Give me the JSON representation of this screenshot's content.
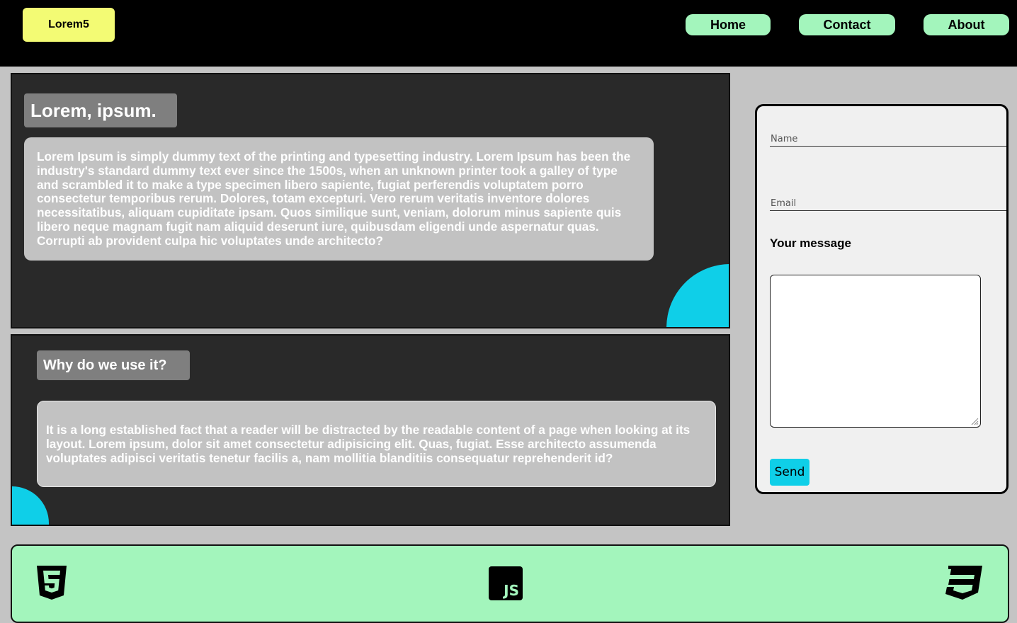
{
  "header": {
    "logo_text": "Lorem5",
    "nav": {
      "home": "Home",
      "contact": "Contact",
      "about": "About"
    }
  },
  "section1": {
    "title": "Lorem, ipsum.",
    "text": "Lorem Ipsum is simply dummy text of the printing and typesetting industry. Lorem Ipsum has been the industry's standard dummy text ever since the 1500s, when an unknown printer took a galley of type and scrambled it to make a type specimen libero sapiente, fugiat perferendis voluptatem porro consectetur temporibus rerum. Dolores, totam excepturi. Vero rerum veritatis inventore dolores necessitatibus, aliquam cupiditate ipsam. Quos similique sunt, veniam, dolorum minus sapiente quis libero neque magnam fugit nam aliquid deserunt iure, quibusdam eligendi unde aspernatur quas. Corrupti ab provident culpa hic voluptates unde architecto?"
  },
  "section2": {
    "title": "Why do we use it?",
    "text": "It is a long established fact that a reader will be distracted by the readable content of a page when looking at its layout. Lorem ipsum, dolor sit amet consectetur adipisicing elit. Quas, fugiat. Esse architecto assumenda voluptates adipisci veritatis tenetur facilis a, nam mollitia blanditiis consequatur reprehenderit id?"
  },
  "form": {
    "name_placeholder": "Name",
    "email_placeholder": "Email",
    "message_label": "Your message",
    "message_value": "",
    "send_label": "Send"
  },
  "footer": {
    "icons": [
      "html5-icon",
      "javascript-icon",
      "css3-icon"
    ],
    "js_text": "JS"
  },
  "colors": {
    "header_bg": "#000000",
    "logo_bg": "#f3fb74",
    "nav_bg": "#a3f5bc",
    "panel_bg": "#292929",
    "accent_cyan": "#0fcfe8",
    "footer_bg": "#a3f5bc"
  }
}
